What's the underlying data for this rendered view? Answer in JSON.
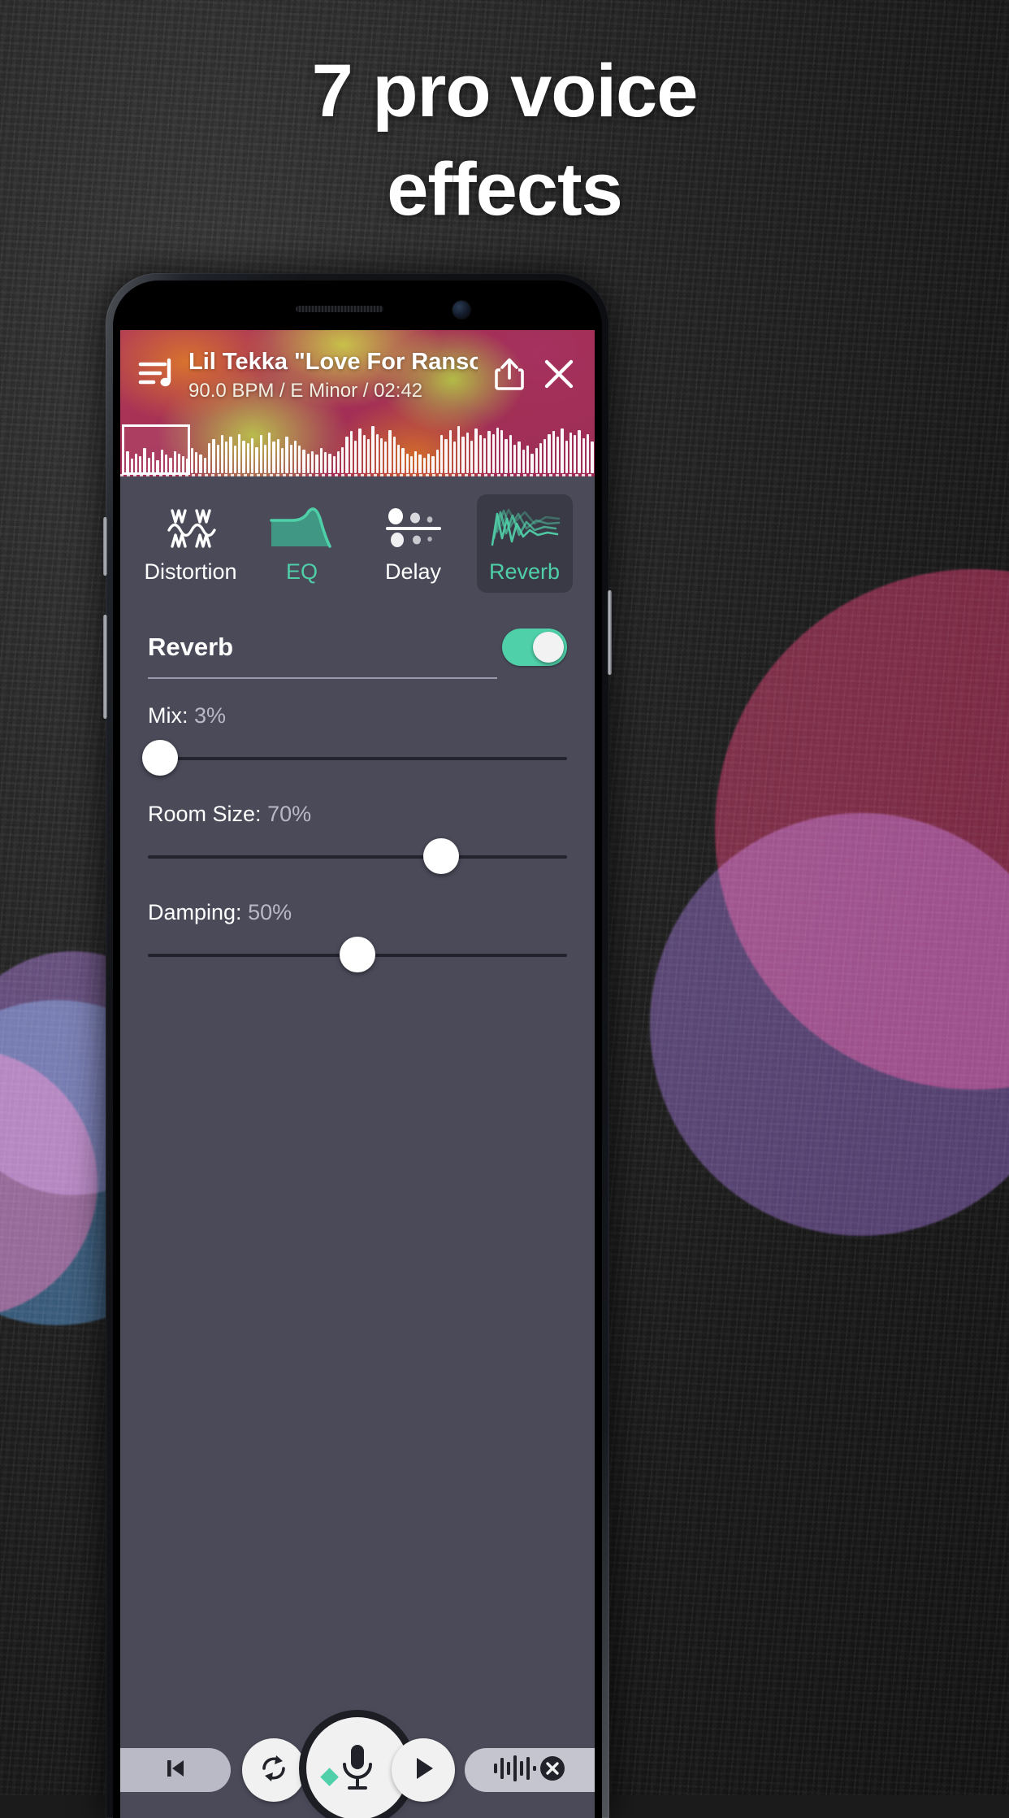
{
  "headline": {
    "line1": "7 pro voice",
    "line2": "effects"
  },
  "colors": {
    "accent_teal": "#4fd0a8",
    "tab_active_bg": "#3a3a47",
    "panel_bg": "#4a4a59",
    "slider_track": "#23232e",
    "value_text": "#b9b9c6"
  },
  "track": {
    "title": "Lil Tekka \"Love For Ranso...",
    "subtitle": "90.0 BPM / E Minor / 02:42",
    "bpm": "90.0 BPM",
    "key": "E Minor",
    "duration": "02:42",
    "playlist_icon": "playlist-music-icon",
    "share_icon": "share-icon",
    "close_icon": "close-icon",
    "waveform_bars": [
      28,
      34,
      22,
      30,
      26,
      38,
      24,
      32,
      20,
      36,
      28,
      24,
      34,
      30,
      26,
      22,
      38,
      32,
      28,
      24,
      46,
      52,
      44,
      58,
      48,
      56,
      42,
      60,
      50,
      46,
      54,
      40,
      58,
      44,
      62,
      48,
      52,
      38,
      56,
      44,
      50,
      42,
      36,
      30,
      34,
      28,
      38,
      32,
      30,
      26,
      34,
      40,
      56,
      64,
      50,
      68,
      58,
      52,
      72,
      60,
      54,
      48,
      66,
      56,
      44,
      38,
      30,
      26,
      34,
      28,
      24,
      30,
      26,
      36,
      58,
      52,
      66,
      48,
      72,
      56,
      62,
      50,
      68,
      58,
      54,
      64,
      60,
      70,
      66,
      52,
      58,
      44,
      48,
      36,
      42,
      30,
      38,
      46,
      52,
      60,
      64,
      56,
      68,
      50,
      62,
      58,
      66,
      54,
      60,
      48
    ]
  },
  "effect_tabs": [
    {
      "label": "Distortion",
      "icon": "distortion-wave-icon",
      "active": false,
      "teal": false
    },
    {
      "label": "EQ",
      "icon": "eq-curve-icon",
      "active": false,
      "teal": true
    },
    {
      "label": "Delay",
      "icon": "delay-dots-icon",
      "active": false,
      "teal": false
    },
    {
      "label": "Reverb",
      "icon": "reverb-waves-icon",
      "active": true,
      "teal": true
    }
  ],
  "panel": {
    "title": "Reverb",
    "enabled": true,
    "toggle_name": "reverb-enable-toggle",
    "params": [
      {
        "name": "mix",
        "label": "Mix:",
        "value": "3%",
        "percent": 3
      },
      {
        "name": "room-size",
        "label": "Room Size:",
        "value": "70%",
        "percent": 70
      },
      {
        "name": "damping",
        "label": "Damping:",
        "value": "50%",
        "percent": 50
      }
    ]
  },
  "transport": {
    "skip_back_icon": "skip-previous-icon",
    "loop_icon": "loop-repeat-icon",
    "record_icon": "microphone-icon",
    "play_icon": "play-icon",
    "clear_waveform_icon": "waveform-clear-icon"
  }
}
